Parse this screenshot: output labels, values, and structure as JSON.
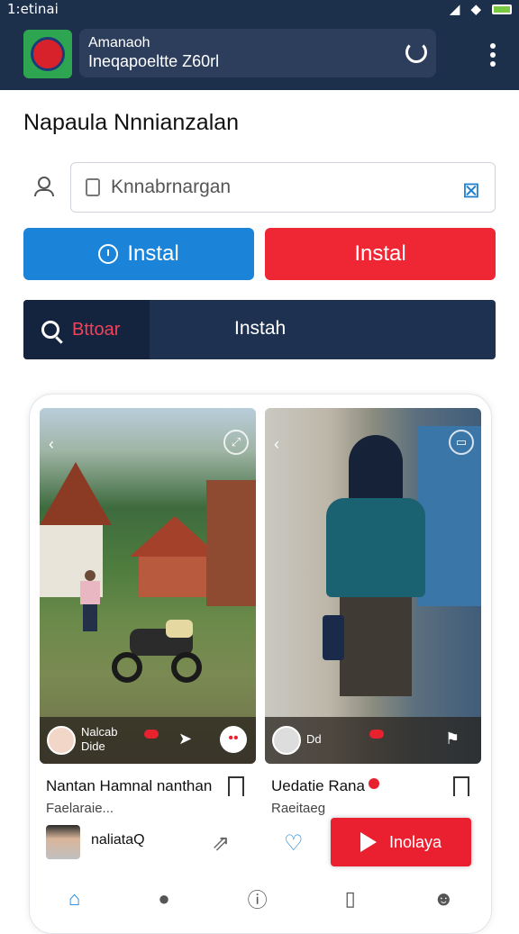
{
  "status_bar": {
    "left_text": "1:etinai",
    "right_icons": [
      "signal-icon",
      "wifi-icon",
      "battery-icon"
    ]
  },
  "app_bar": {
    "line1": "Amanaoh",
    "line2": "Ineqapoeltte Z60rl"
  },
  "page_title": "Napaula Nnnianzalan",
  "search": {
    "value": "Knnabrnargan"
  },
  "buttons": {
    "blue_label": "Instal",
    "red_label": "Instal"
  },
  "segment": {
    "left_label": "Bttoar",
    "right_label": "Instah"
  },
  "feed": {
    "card1": {
      "overlay_name": "Nalcab",
      "overlay_sub": "Dide",
      "title": "Nantan Hamnal nanthan",
      "subtitle": "Faelaraie..."
    },
    "card2": {
      "overlay_sub": "Dd",
      "title": "Uedatie Rana",
      "subtitle": "Raeitaeg"
    },
    "user_name": "naliataQ",
    "play_label": "Inolaya"
  },
  "colors": {
    "header": "#1c2f4b",
    "blue": "#1c84d8",
    "red": "#ef2734"
  }
}
